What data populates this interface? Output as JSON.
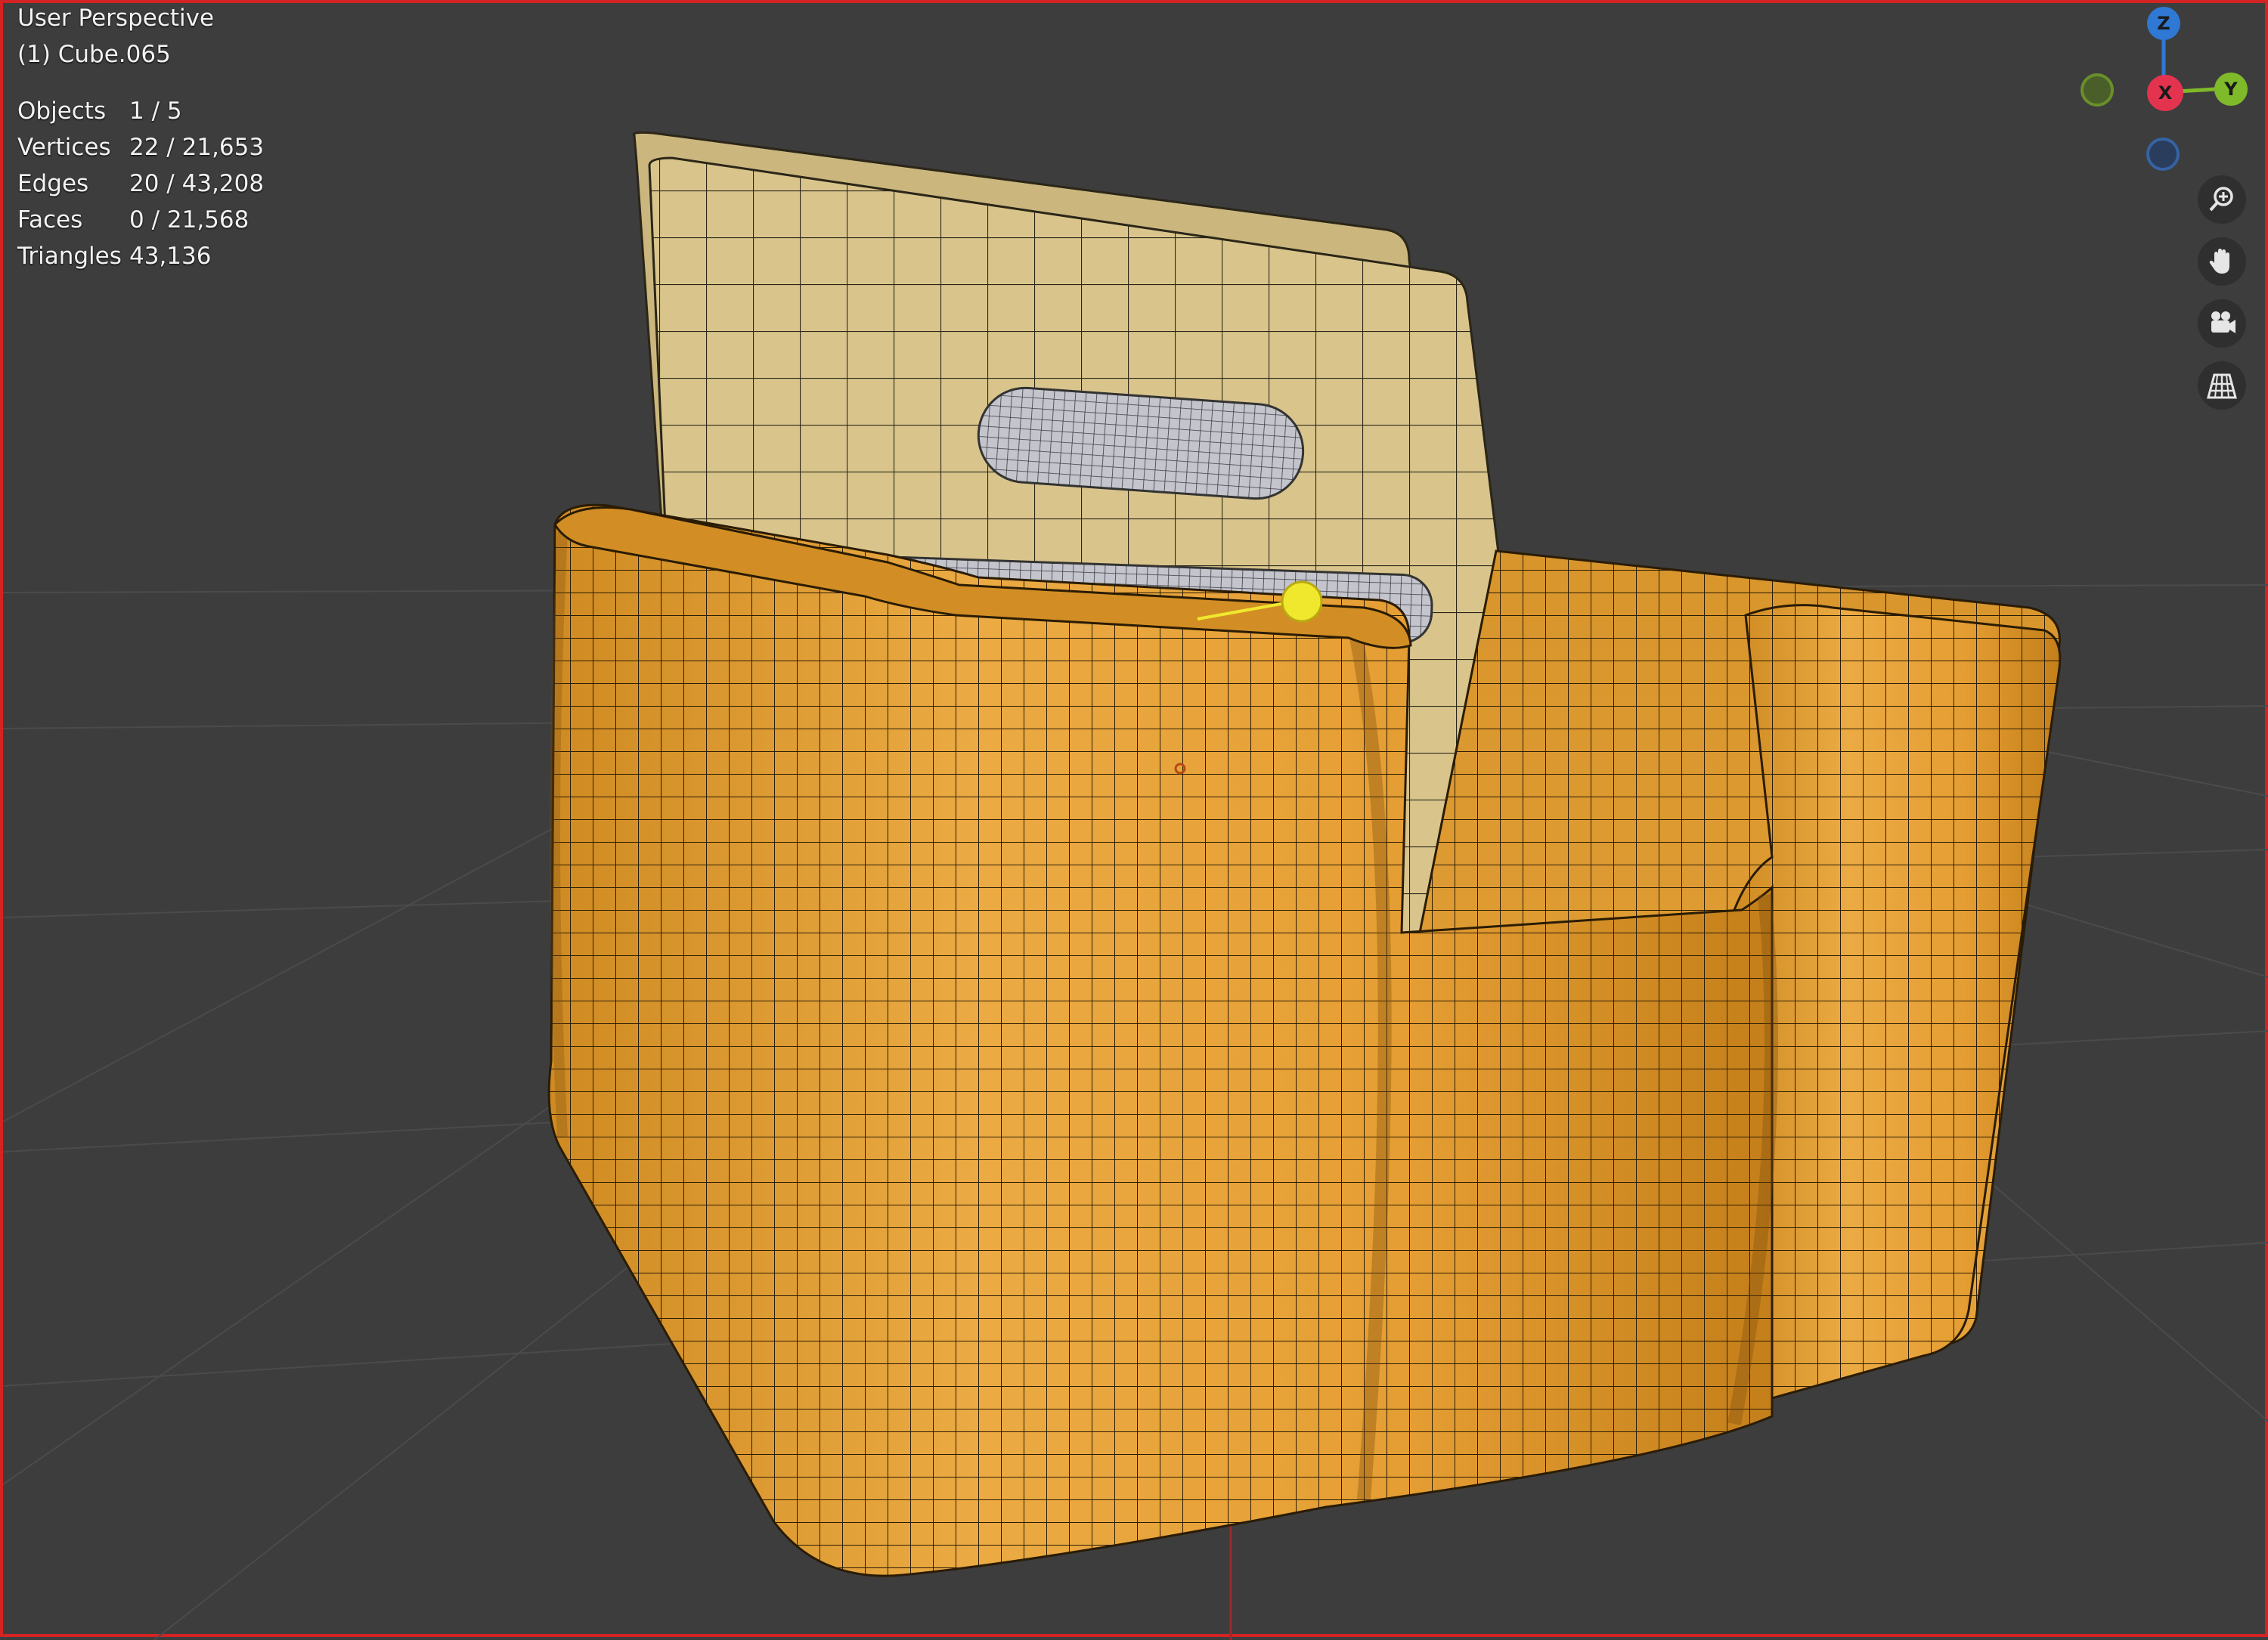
{
  "viewport": {
    "title": "User Perspective",
    "object_name": "(1) Cube.065",
    "border_color": "#d42323",
    "background_color": "#3d3d3d"
  },
  "stats": [
    {
      "label": "Objects",
      "value": "1 / 5"
    },
    {
      "label": "Vertices",
      "value": "22 / 21,653"
    },
    {
      "label": "Edges",
      "value": "20 / 43,208"
    },
    {
      "label": "Faces",
      "value": "0 / 21,568"
    },
    {
      "label": "Triangles",
      "value": "43,136"
    }
  ],
  "gizmo": {
    "axes": [
      {
        "name": "Z",
        "color": "#2f78d4"
      },
      {
        "name": "X",
        "color": "#e4334f"
      },
      {
        "name": "Y",
        "color": "#7fba2a"
      }
    ],
    "negative_axis_colors": {
      "y": "#6a8f2a",
      "z": "#3563a4"
    }
  },
  "nav_tools": [
    {
      "name": "zoom",
      "icon": "zoom-icon"
    },
    {
      "name": "pan",
      "icon": "hand-icon"
    },
    {
      "name": "camera",
      "icon": "camera-icon"
    },
    {
      "name": "perspective-toggle",
      "icon": "grid-perspective-icon"
    }
  ],
  "model": {
    "body_color": "#e7a33b",
    "cushion_color": "#d9c58c",
    "handle_color": "#b9b9c3",
    "selected_vertex_color": "#f0e82c"
  }
}
